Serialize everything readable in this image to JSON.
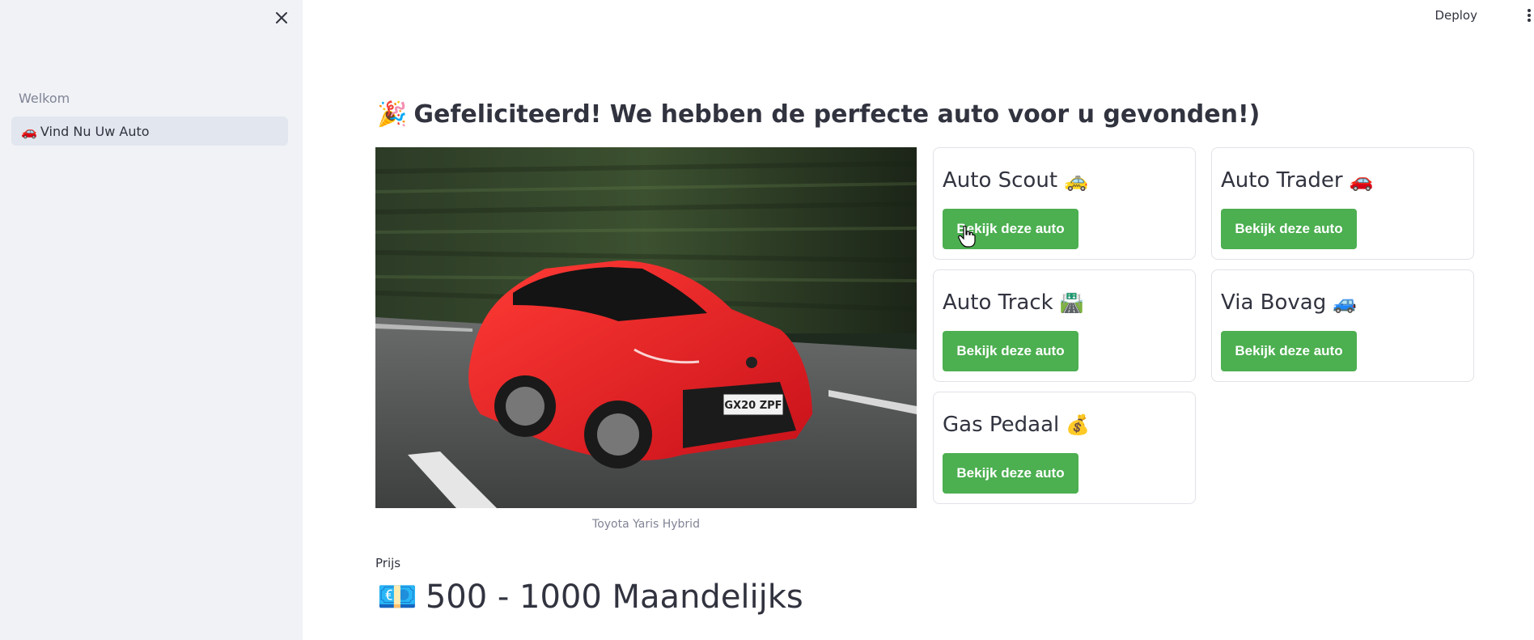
{
  "sidebar": {
    "close_icon": "close-icon",
    "group_label": "Welkom",
    "items": [
      {
        "emoji": "🚗",
        "label": "Vind Nu Uw Auto",
        "active": true
      }
    ]
  },
  "topbar": {
    "deploy_label": "Deploy",
    "menu_icon": "kebab-menu-icon"
  },
  "main": {
    "title_emoji": "🎉",
    "title": "Gefeliciteerd! We hebben de perfecte auto voor u gevonden!)",
    "image_caption": "Toyota Yaris Hybrid",
    "car_plate": "GX20 ZPF",
    "cards": [
      {
        "title": "Auto Scout",
        "emoji": "🚕",
        "button": "Bekijk deze auto"
      },
      {
        "title": "Auto Trader",
        "emoji": "🚗",
        "button": "Bekijk deze auto"
      },
      {
        "title": "Auto Track",
        "emoji": "🛣️",
        "button": "Bekijk deze auto"
      },
      {
        "title": "Via Bovag",
        "emoji": "🚙",
        "button": "Bekijk deze auto"
      },
      {
        "title": "Gas Pedaal",
        "emoji": "💰",
        "button": "Bekijk deze auto"
      }
    ],
    "price": {
      "label": "Prijs",
      "emoji": "💶",
      "value": "500 - 1000 Maandelijks"
    }
  },
  "colors": {
    "sidebar_bg": "#f0f2f6",
    "button_green": "#4caf50",
    "text": "#31333f",
    "muted": "#808495"
  }
}
